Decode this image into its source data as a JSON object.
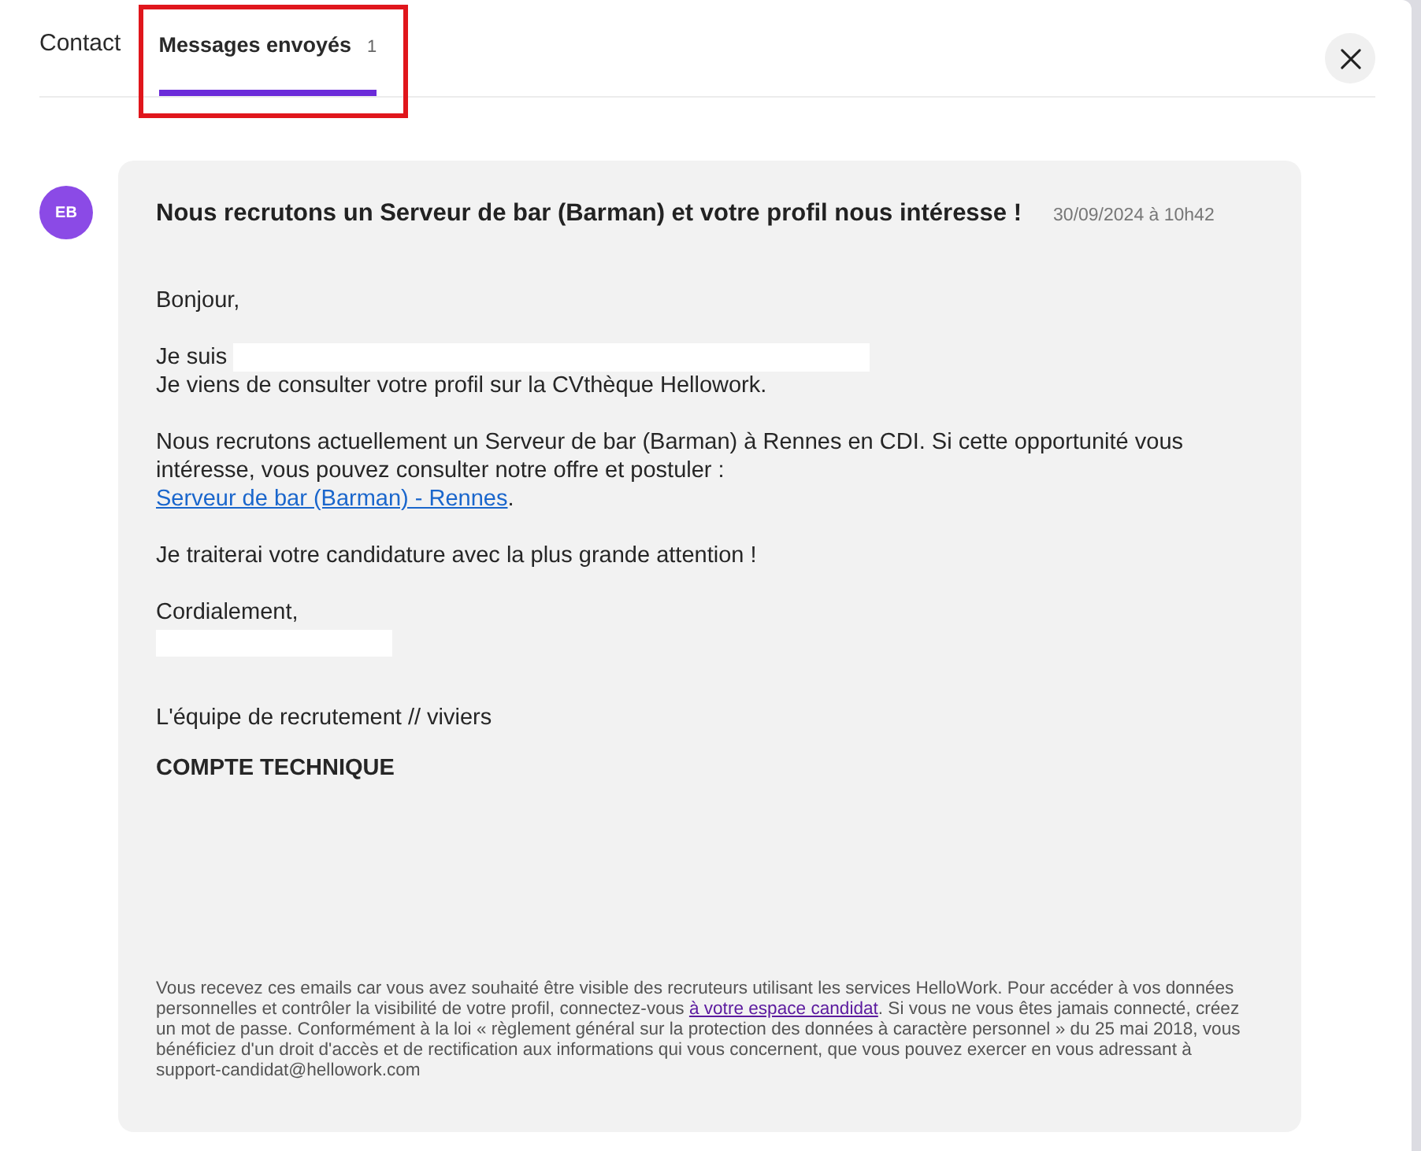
{
  "tabs": [
    {
      "label": "Contact",
      "selected": false,
      "highlighted": false
    },
    {
      "label": "Messages envoyés",
      "count": "1",
      "selected": true,
      "highlighted": true
    }
  ],
  "message": {
    "sender_initials": "EB",
    "title": "Nous recrutons un Serveur de bar (Barman) et votre profil nous intéresse !",
    "date": "30/09/2024 à 10h42",
    "body": [
      {
        "kind": "paragraph",
        "lines": [
          {
            "kind": "text",
            "text": "Bonjour,"
          }
        ]
      },
      {
        "kind": "paragraph",
        "lines": [
          {
            "kind": "redacted",
            "text": "Je suis"
          },
          {
            "kind": "text",
            "text": "Je viens de consulter votre profil sur la CVthèque Hellowork."
          }
        ]
      },
      {
        "kind": "paragraph",
        "lines": [
          {
            "kind": "link",
            "text": "Nous recrutons actuellement un Serveur de bar (Barman) à Rennes en CDI. Si cette opportunité vous intéresse, vous pouvez consulter notre offre et postuler :",
            "link": "Serveur de bar (Barman) - Rennes",
            "text_after": "."
          }
        ]
      },
      {
        "kind": "paragraph",
        "lines": [
          {
            "kind": "text",
            "text": "Je traiterai votre candidature avec la plus grande attention !"
          }
        ]
      },
      {
        "kind": "closing",
        "lines": [
          {
            "kind": "text",
            "text": "Cordialement,"
          },
          {
            "kind": "redacted"
          }
        ]
      },
      {
        "kind": "signature",
        "lines": [
          {
            "kind": "text",
            "text": "L'équipe de recrutement // viviers"
          }
        ]
      },
      {
        "kind": "company",
        "lines": [
          {
            "kind": "text",
            "text": "COMPTE TECHNIQUE"
          }
        ]
      }
    ],
    "footer": {
      "text": "Vous recevez ces emails car vous avez souhaité être visible des recruteurs utilisant les services HelloWork. Pour accéder à vos données personnelles et contrôler la visibilité de votre profil, connectez-vous ",
      "link": "à votre espace candidat",
      "text_after": ". Si vous ne vous êtes jamais connecté, créez un mot de passe. Conformément à la loi « règlement général sur la protection des données à caractère personnel » du 25 mai 2018, vous bénéficiez d'un droit d'accès et de rectification aux informations qui vous concernent, que vous pouvez exercer en vous adressant à support-candidat@hellowork.com"
    }
  }
}
